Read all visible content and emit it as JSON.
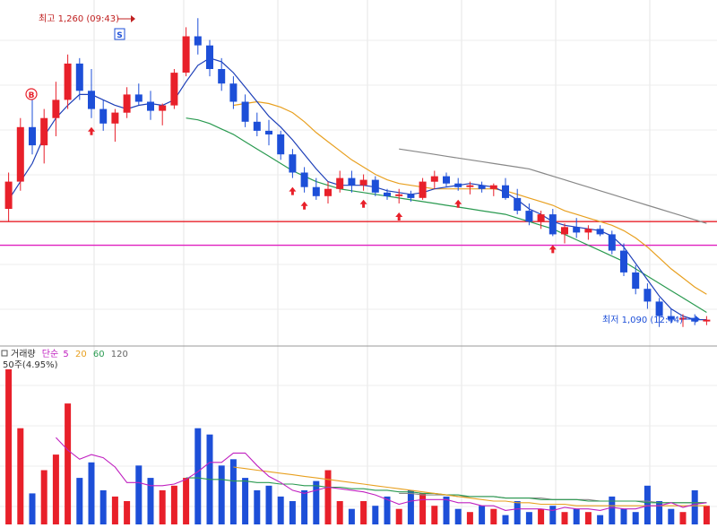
{
  "price_panel": {
    "high_label": "최고 1,260 (09:43)",
    "low_label": "최저 1,090 (12:44)",
    "high_value": 1260,
    "low_value": 1090,
    "buy_badge": "B",
    "sell_badge": "S",
    "hline_red_value": 1148,
    "hline_magenta_value": 1135,
    "up_color": "#e8202a",
    "down_color": "#1d4fd8",
    "hline_red_color": "#e8202a",
    "hline_magenta_color": "#e020c0",
    "ma_colors": {
      "ma5": "#1d3fb8",
      "ma20": "#e8a020",
      "ma60": "#2a9a50",
      "ma120": "#888888"
    }
  },
  "volume_panel": {
    "header": {
      "prefix": "거래량",
      "ma_type": "단순",
      "p5": "5",
      "p20": "20",
      "p60": "60",
      "p120": "120"
    },
    "sub_label": "50주(4.95%)"
  },
  "chart_data": {
    "type": "candlestick",
    "price_range": [
      1080,
      1270
    ],
    "candles": [
      {
        "o": 1155,
        "h": 1175,
        "l": 1148,
        "c": 1170
      },
      {
        "o": 1170,
        "h": 1205,
        "l": 1165,
        "c": 1200
      },
      {
        "o": 1200,
        "h": 1215,
        "l": 1185,
        "c": 1190
      },
      {
        "o": 1190,
        "h": 1210,
        "l": 1180,
        "c": 1205
      },
      {
        "o": 1205,
        "h": 1225,
        "l": 1195,
        "c": 1215
      },
      {
        "o": 1215,
        "h": 1240,
        "l": 1210,
        "c": 1235
      },
      {
        "o": 1235,
        "h": 1238,
        "l": 1215,
        "c": 1220
      },
      {
        "o": 1220,
        "h": 1232,
        "l": 1205,
        "c": 1210
      },
      {
        "o": 1210,
        "h": 1215,
        "l": 1198,
        "c": 1202
      },
      {
        "o": 1202,
        "h": 1210,
        "l": 1192,
        "c": 1208
      },
      {
        "o": 1208,
        "h": 1222,
        "l": 1205,
        "c": 1218
      },
      {
        "o": 1218,
        "h": 1224,
        "l": 1212,
        "c": 1214
      },
      {
        "o": 1214,
        "h": 1220,
        "l": 1204,
        "c": 1209
      },
      {
        "o": 1209,
        "h": 1213,
        "l": 1201,
        "c": 1212
      },
      {
        "o": 1212,
        "h": 1232,
        "l": 1210,
        "c": 1230
      },
      {
        "o": 1230,
        "h": 1255,
        "l": 1228,
        "c": 1250
      },
      {
        "o": 1250,
        "h": 1260,
        "l": 1240,
        "c": 1245
      },
      {
        "o": 1245,
        "h": 1248,
        "l": 1228,
        "c": 1232
      },
      {
        "o": 1232,
        "h": 1238,
        "l": 1220,
        "c": 1224
      },
      {
        "o": 1224,
        "h": 1228,
        "l": 1210,
        "c": 1214
      },
      {
        "o": 1214,
        "h": 1218,
        "l": 1200,
        "c": 1203
      },
      {
        "o": 1203,
        "h": 1208,
        "l": 1195,
        "c": 1198
      },
      {
        "o": 1198,
        "h": 1204,
        "l": 1190,
        "c": 1196
      },
      {
        "o": 1196,
        "h": 1198,
        "l": 1182,
        "c": 1185
      },
      {
        "o": 1185,
        "h": 1188,
        "l": 1172,
        "c": 1175
      },
      {
        "o": 1175,
        "h": 1178,
        "l": 1164,
        "c": 1167
      },
      {
        "o": 1167,
        "h": 1172,
        "l": 1160,
        "c": 1162
      },
      {
        "o": 1162,
        "h": 1170,
        "l": 1158,
        "c": 1166
      },
      {
        "o": 1166,
        "h": 1176,
        "l": 1164,
        "c": 1172
      },
      {
        "o": 1172,
        "h": 1176,
        "l": 1164,
        "c": 1168
      },
      {
        "o": 1168,
        "h": 1174,
        "l": 1165,
        "c": 1171
      },
      {
        "o": 1171,
        "h": 1173,
        "l": 1162,
        "c": 1164
      },
      {
        "o": 1164,
        "h": 1166,
        "l": 1160,
        "c": 1162
      },
      {
        "o": 1162,
        "h": 1166,
        "l": 1158,
        "c": 1163
      },
      {
        "o": 1163,
        "h": 1165,
        "l": 1159,
        "c": 1161
      },
      {
        "o": 1161,
        "h": 1172,
        "l": 1160,
        "c": 1170
      },
      {
        "o": 1170,
        "h": 1176,
        "l": 1166,
        "c": 1173
      },
      {
        "o": 1173,
        "h": 1175,
        "l": 1167,
        "c": 1169
      },
      {
        "o": 1169,
        "h": 1172,
        "l": 1165,
        "c": 1167
      },
      {
        "o": 1167,
        "h": 1170,
        "l": 1163,
        "c": 1168
      },
      {
        "o": 1168,
        "h": 1170,
        "l": 1164,
        "c": 1166
      },
      {
        "o": 1166,
        "h": 1169,
        "l": 1162,
        "c": 1168
      },
      {
        "o": 1168,
        "h": 1172,
        "l": 1160,
        "c": 1161
      },
      {
        "o": 1161,
        "h": 1166,
        "l": 1152,
        "c": 1154
      },
      {
        "o": 1154,
        "h": 1158,
        "l": 1146,
        "c": 1148
      },
      {
        "o": 1148,
        "h": 1154,
        "l": 1144,
        "c": 1152
      },
      {
        "o": 1152,
        "h": 1155,
        "l": 1140,
        "c": 1141
      },
      {
        "o": 1141,
        "h": 1147,
        "l": 1136,
        "c": 1145
      },
      {
        "o": 1145,
        "h": 1150,
        "l": 1139,
        "c": 1142
      },
      {
        "o": 1142,
        "h": 1146,
        "l": 1138,
        "c": 1144
      },
      {
        "o": 1144,
        "h": 1146,
        "l": 1140,
        "c": 1141
      },
      {
        "o": 1141,
        "h": 1143,
        "l": 1130,
        "c": 1132
      },
      {
        "o": 1132,
        "h": 1136,
        "l": 1118,
        "c": 1120
      },
      {
        "o": 1120,
        "h": 1124,
        "l": 1108,
        "c": 1111
      },
      {
        "o": 1111,
        "h": 1114,
        "l": 1100,
        "c": 1104
      },
      {
        "o": 1104,
        "h": 1106,
        "l": 1090,
        "c": 1096
      },
      {
        "o": 1096,
        "h": 1100,
        "l": 1092,
        "c": 1094
      },
      {
        "o": 1094,
        "h": 1097,
        "l": 1090,
        "c": 1095
      },
      {
        "o": 1095,
        "h": 1097,
        "l": 1091,
        "c": 1093
      },
      {
        "o": 1093,
        "h": 1096,
        "l": 1091,
        "c": 1094
      }
    ],
    "ma5": [
      1160,
      1170,
      1180,
      1195,
      1205,
      1212,
      1218,
      1218,
      1215,
      1212,
      1210,
      1212,
      1213,
      1212,
      1215,
      1225,
      1234,
      1238,
      1236,
      1230,
      1222,
      1214,
      1206,
      1200,
      1193,
      1185,
      1177,
      1170,
      1168,
      1168,
      1168,
      1167,
      1165,
      1164,
      1163,
      1164,
      1166,
      1167,
      1168,
      1169,
      1168,
      1167,
      1164,
      1160,
      1155,
      1152,
      1148,
      1146,
      1145,
      1144,
      1143,
      1140,
      1134,
      1125,
      1116,
      1107,
      1100,
      1096,
      1094,
      1094
    ],
    "ma20": [
      null,
      null,
      null,
      null,
      null,
      null,
      null,
      null,
      null,
      null,
      null,
      null,
      null,
      null,
      null,
      null,
      null,
      null,
      null,
      1212,
      1213,
      1214,
      1213,
      1211,
      1208,
      1203,
      1197,
      1192,
      1187,
      1182,
      1178,
      1174,
      1171,
      1169,
      1168,
      1167,
      1166,
      1166,
      1166,
      1166,
      1166,
      1166,
      1165,
      1163,
      1161,
      1159,
      1157,
      1154,
      1152,
      1150,
      1148,
      1146,
      1143,
      1139,
      1134,
      1128,
      1122,
      1117,
      1112,
      1108
    ],
    "ma60": [
      null,
      null,
      null,
      null,
      null,
      null,
      null,
      null,
      null,
      null,
      null,
      null,
      null,
      null,
      null,
      1205,
      1204,
      1202,
      1199,
      1196,
      1192,
      1188,
      1184,
      1180,
      1176,
      1173,
      1170,
      1168,
      1166,
      1165,
      1164,
      1163,
      1162,
      1161,
      1160,
      1159,
      1158,
      1157,
      1156,
      1155,
      1154,
      1153,
      1152,
      1150,
      1148,
      1146,
      1144,
      1141,
      1138,
      1135,
      1132,
      1129,
      1126,
      1122,
      1118,
      1114,
      1110,
      1106,
      1102,
      1098
    ],
    "ma120": [
      null,
      null,
      null,
      null,
      null,
      null,
      null,
      null,
      null,
      null,
      null,
      null,
      null,
      null,
      null,
      null,
      null,
      null,
      null,
      null,
      null,
      null,
      null,
      null,
      null,
      null,
      null,
      null,
      null,
      null,
      null,
      null,
      null,
      1188,
      1187,
      1186,
      1185,
      1184,
      1183,
      1182,
      1181,
      1180,
      1179,
      1178,
      1177,
      1175,
      1173,
      1171,
      1169,
      1167,
      1165,
      1163,
      1161,
      1159,
      1157,
      1155,
      1153,
      1151,
      1149,
      1147
    ],
    "volume_max": 100,
    "volume": [
      100,
      62,
      20,
      35,
      45,
      78,
      30,
      40,
      22,
      18,
      15,
      38,
      30,
      22,
      25,
      30,
      62,
      58,
      38,
      42,
      30,
      22,
      25,
      18,
      15,
      22,
      28,
      35,
      15,
      10,
      15,
      12,
      18,
      10,
      22,
      20,
      12,
      18,
      10,
      8,
      12,
      10,
      6,
      15,
      8,
      10,
      12,
      8,
      10,
      8,
      6,
      18,
      10,
      8,
      25,
      15,
      10,
      8,
      22,
      12
    ],
    "volume_ma5": [
      null,
      null,
      null,
      null,
      56,
      48,
      42,
      45,
      43,
      37,
      27,
      27,
      25,
      25,
      26,
      29,
      34,
      40,
      40,
      46,
      46,
      38,
      31,
      27,
      22,
      20,
      22,
      24,
      23,
      22,
      21,
      19,
      16,
      13,
      15,
      16,
      16,
      16,
      14,
      14,
      12,
      12,
      9,
      10,
      10,
      10,
      9,
      11,
      10,
      10,
      9,
      11,
      10,
      10,
      12,
      12,
      14,
      11,
      13,
      14
    ],
    "volume_ma20": [
      null,
      null,
      null,
      null,
      null,
      null,
      null,
      null,
      null,
      null,
      null,
      null,
      null,
      null,
      null,
      null,
      null,
      null,
      null,
      37,
      36,
      35,
      34,
      33,
      32,
      31,
      30,
      29,
      28,
      27,
      26,
      25,
      24,
      23,
      22,
      21,
      20,
      19,
      18,
      17,
      16,
      15,
      15,
      14,
      14,
      13,
      13,
      13,
      12,
      12,
      12,
      12,
      12,
      12,
      12,
      12,
      12,
      12,
      12,
      12
    ],
    "volume_ma60": [
      null,
      null,
      null,
      null,
      null,
      null,
      null,
      null,
      null,
      null,
      null,
      null,
      null,
      null,
      null,
      30,
      30,
      29,
      29,
      28,
      28,
      27,
      27,
      26,
      26,
      25,
      25,
      24,
      24,
      23,
      23,
      22,
      22,
      21,
      21,
      20,
      20,
      19,
      19,
      18,
      18,
      18,
      17,
      17,
      17,
      16,
      16,
      16,
      16,
      15,
      15,
      15,
      15,
      15,
      14,
      14,
      14,
      14,
      14,
      14
    ],
    "volume_ma120": [
      null,
      null,
      null,
      null,
      null,
      null,
      null,
      null,
      null,
      null,
      null,
      null,
      null,
      null,
      null,
      null,
      null,
      null,
      null,
      null,
      null,
      null,
      null,
      null,
      null,
      null,
      null,
      null,
      null,
      null,
      null,
      null,
      null,
      20,
      20,
      19,
      19,
      19,
      18,
      18,
      18,
      18,
      17,
      17,
      17,
      17,
      16,
      16,
      16,
      16,
      15,
      15,
      15,
      15,
      15,
      14,
      14,
      14,
      14,
      14
    ],
    "buy_signals": [
      7,
      24,
      25,
      30,
      33,
      38,
      46
    ],
    "sell_signals": [],
    "high_index": 16,
    "low_index": 55
  }
}
